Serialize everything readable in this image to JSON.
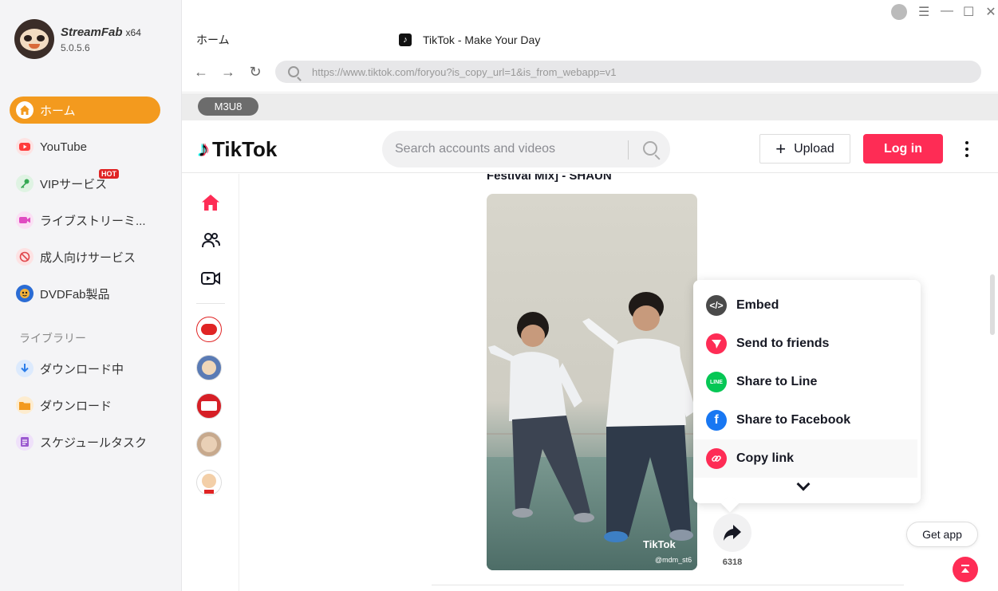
{
  "app": {
    "name": "StreamFab",
    "arch": "x64",
    "version": "5.0.5.6"
  },
  "sidebar": {
    "items": [
      {
        "label": "ホーム",
        "icon": "home-icon",
        "color": "#f39a1e"
      },
      {
        "label": "YouTube",
        "icon": "youtube-icon",
        "color": "#ff3b3b"
      },
      {
        "label": "VIPサービス",
        "icon": "key-icon",
        "color": "#34a853",
        "badge": "HOT"
      },
      {
        "label": "ライブストリーミ...",
        "icon": "camera-icon",
        "color": "#e04cc1"
      },
      {
        "label": "成人向けサービス",
        "icon": "adult-icon",
        "color": "#e0474c"
      },
      {
        "label": "DVDFab製品",
        "icon": "dvdfab-icon",
        "color": "#2b6cd4"
      }
    ],
    "library_label": "ライブラリー",
    "library": [
      {
        "label": "ダウンロード中",
        "icon": "downloading-icon",
        "color": "#2b7de9"
      },
      {
        "label": "ダウンロード",
        "icon": "folder-icon",
        "color": "#f39a1e"
      },
      {
        "label": "スケジュールタスク",
        "icon": "schedule-icon",
        "color": "#9b59d0"
      }
    ]
  },
  "tabs": {
    "home": "ホーム",
    "active": "TikTok - Make Your Day"
  },
  "browser": {
    "url": "https://www.tiktok.com/foryou?is_copy_url=1&is_from_webapp=v1",
    "m3u8_label": "M3U8"
  },
  "tiktok": {
    "logo_text": "TikTok",
    "search_placeholder": "Search accounts and videos",
    "upload_label": "Upload",
    "login_label": "Log in",
    "video_title": "Festival Mix] - SHAUN",
    "watermark": "TikTok",
    "watermark_handle": "@mdm_st6",
    "share_menu": [
      {
        "label": "Embed",
        "icon": "embed-icon",
        "color": "#4a4a4a"
      },
      {
        "label": "Send to friends",
        "icon": "send-icon",
        "color": "#fe2c55"
      },
      {
        "label": "Share to Line",
        "icon": "line-icon",
        "color": "#06c755"
      },
      {
        "label": "Share to Facebook",
        "icon": "facebook-icon",
        "color": "#1877f2"
      },
      {
        "label": "Copy link",
        "icon": "link-icon",
        "color": "#fe2c55"
      }
    ],
    "share_count": "6318",
    "get_app": "Get app",
    "brand_color": "#fe2c55"
  }
}
